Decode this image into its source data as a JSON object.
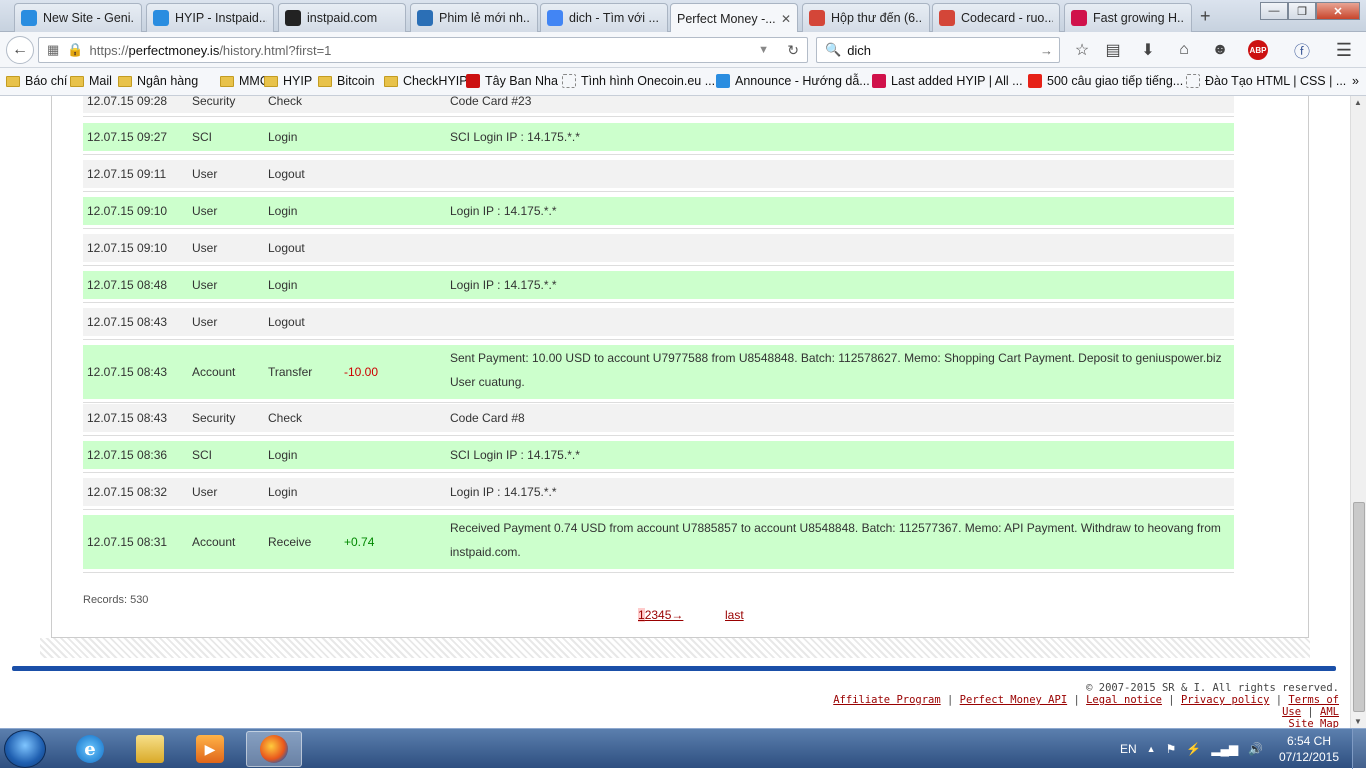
{
  "tabs": [
    {
      "label": "New Site - Geni...",
      "icon": "s-circle-icon",
      "color": "#2a8de0"
    },
    {
      "label": "HYIP - Instpaid...",
      "icon": "s-circle-icon",
      "color": "#2a8de0"
    },
    {
      "label": "instpaid.com",
      "icon": "ip-icon",
      "color": "#222222"
    },
    {
      "label": "Phim lẻ mới nh...",
      "icon": "video-icon",
      "color": "#2b6fb6"
    },
    {
      "label": "dich - Tìm với ...",
      "icon": "google-icon",
      "color": "#4285f4"
    },
    {
      "label": "Perfect Money -...",
      "icon": "none",
      "color": "#ffffff",
      "active": true
    },
    {
      "label": "Hộp thư đến (6...",
      "icon": "gmail-icon",
      "color": "#d44638"
    },
    {
      "label": "Codecard - ruo...",
      "icon": "gmail-icon",
      "color": "#d44638"
    },
    {
      "label": "Fast growing H...",
      "icon": "a-icon",
      "color": "#d0114a"
    }
  ],
  "window": {
    "minimize": "—",
    "maximize": "❐",
    "close": "✕",
    "new_tab": "+"
  },
  "nav": {
    "url_prefix": "https://",
    "url_domain": "perfectmoney.is",
    "url_path": "/history.html?first=1",
    "search_value": "dich"
  },
  "bookmarks": [
    {
      "label": "Báo chí",
      "icon": "folder"
    },
    {
      "label": "Mail",
      "icon": "folder"
    },
    {
      "label": "Ngân hàng",
      "icon": "folder"
    },
    {
      "label": "MMO",
      "icon": "folder"
    },
    {
      "label": "HYIP",
      "icon": "folder"
    },
    {
      "label": "Bitcoin",
      "icon": "folder"
    },
    {
      "label": "CheckHYIP",
      "icon": "folder"
    },
    {
      "label": "Tây Ban Nha",
      "icon": "t-icon"
    },
    {
      "label": "Tình hình Onecoin.eu ...",
      "icon": "blank-page-icon"
    },
    {
      "label": "Announce - Hướng dẫ...",
      "icon": "s-circle-icon"
    },
    {
      "label": "Last added HYIP | All ...",
      "icon": "a-icon"
    },
    {
      "label": "500 câu giao tiếp tiếng...",
      "icon": "youtube-icon"
    },
    {
      "label": "Đào Tạo HTML | CSS | ...",
      "icon": "blank-page-icon"
    }
  ],
  "history": [
    {
      "date": "12.07.15 09:28",
      "type": "Security",
      "action": "Check",
      "amount": "",
      "desc": "Code Card #23",
      "color": "gray"
    },
    {
      "date": "12.07.15 09:27",
      "type": "SCI",
      "action": "Login",
      "amount": "",
      "desc": "SCI Login IP : 14.175.*.*",
      "color": "green"
    },
    {
      "date": "12.07.15 09:11",
      "type": "User",
      "action": "Logout",
      "amount": "",
      "desc": "",
      "color": "gray"
    },
    {
      "date": "12.07.15 09:10",
      "type": "User",
      "action": "Login",
      "amount": "",
      "desc": "Login IP : 14.175.*.*",
      "color": "green"
    },
    {
      "date": "12.07.15 09:10",
      "type": "User",
      "action": "Logout",
      "amount": "",
      "desc": "",
      "color": "gray"
    },
    {
      "date": "12.07.15 08:48",
      "type": "User",
      "action": "Login",
      "amount": "",
      "desc": "Login IP : 14.175.*.*",
      "color": "green"
    },
    {
      "date": "12.07.15 08:43",
      "type": "User",
      "action": "Logout",
      "amount": "",
      "desc": "",
      "color": "gray"
    },
    {
      "date": "12.07.15 08:43",
      "type": "Account",
      "action": "Transfer",
      "amount": "-10.00",
      "desc": "Sent Payment: 10.00 USD to account U7977588 from U8548848. Batch: 112578627. Memo: Shopping Cart Payment. Deposit to geniuspower.biz User cuatung.",
      "color": "green"
    },
    {
      "date": "12.07.15 08:43",
      "type": "Security",
      "action": "Check",
      "amount": "",
      "desc": "Code Card #8",
      "color": "gray"
    },
    {
      "date": "12.07.15 08:36",
      "type": "SCI",
      "action": "Login",
      "amount": "",
      "desc": "SCI Login IP : 14.175.*.*",
      "color": "green"
    },
    {
      "date": "12.07.15 08:32",
      "type": "User",
      "action": "Login",
      "amount": "",
      "desc": "Login IP : 14.175.*.*",
      "color": "gray"
    },
    {
      "date": "12.07.15 08:31",
      "type": "Account",
      "action": "Receive",
      "amount": "+0.74",
      "desc": "Received Payment 0.74 USD from account U7885857 to account U8548848. Batch: 112577367. Memo: API Payment. Withdraw to heovang from instpaid.com.",
      "color": "green"
    }
  ],
  "records": "Records: 530",
  "pager": {
    "current": "1",
    "rest": "2345→",
    "last": "last"
  },
  "footer": {
    "copyright": "© 2007-2015 SR & I. All rights reserved.",
    "links": [
      "Affiliate Program",
      "Perfect Money API",
      "Legal notice",
      "Privacy policy",
      "Terms of Use",
      "AML",
      "Site Map"
    ]
  },
  "tray": {
    "lang": "EN",
    "time": "6:54 CH",
    "date": "07/12/2015"
  }
}
